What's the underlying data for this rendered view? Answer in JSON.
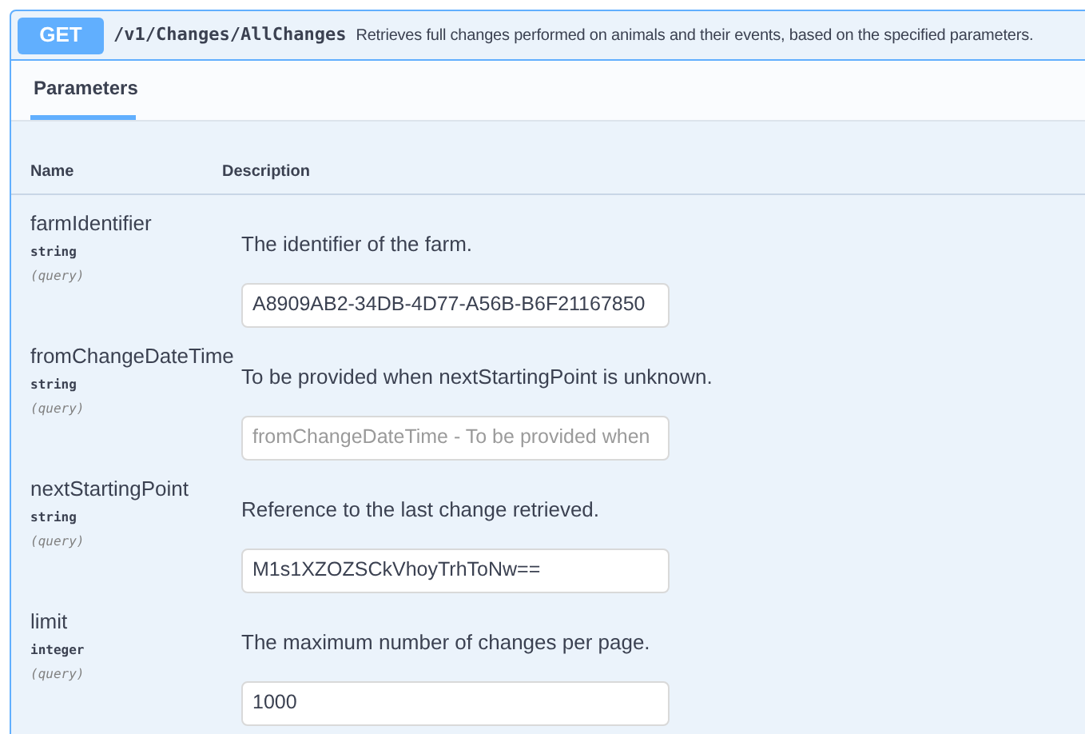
{
  "operation": {
    "method": "GET",
    "path": "/v1/Changes/AllChanges",
    "summary": "Retrieves full changes performed on animals and their events, based on the specified parameters."
  },
  "tabs": [
    {
      "label": "Parameters",
      "selected": true
    }
  ],
  "table": {
    "columns": [
      "Name",
      "Description"
    ],
    "rows": [
      {
        "name": "farmIdentifier",
        "type": "string",
        "location": "(query)",
        "description": "The identifier of the farm.",
        "value": "A8909AB2-34DB-4D77-A56B-B6F21167850"
      },
      {
        "name": "fromChangeDateTime",
        "type": "string",
        "location": "(query)",
        "description": "To be provided when nextStartingPoint is unknown.",
        "placeholder": "fromChangeDateTime - To be provided when"
      },
      {
        "name": "nextStartingPoint",
        "type": "string",
        "location": "(query)",
        "description": "Reference to the last change retrieved.",
        "value": "M1s1XZOZSCkVhoyTrhToNw=="
      },
      {
        "name": "limit",
        "type": "integer",
        "location": "(query)",
        "description": "The maximum number of changes per page.",
        "value": "1000"
      }
    ]
  }
}
